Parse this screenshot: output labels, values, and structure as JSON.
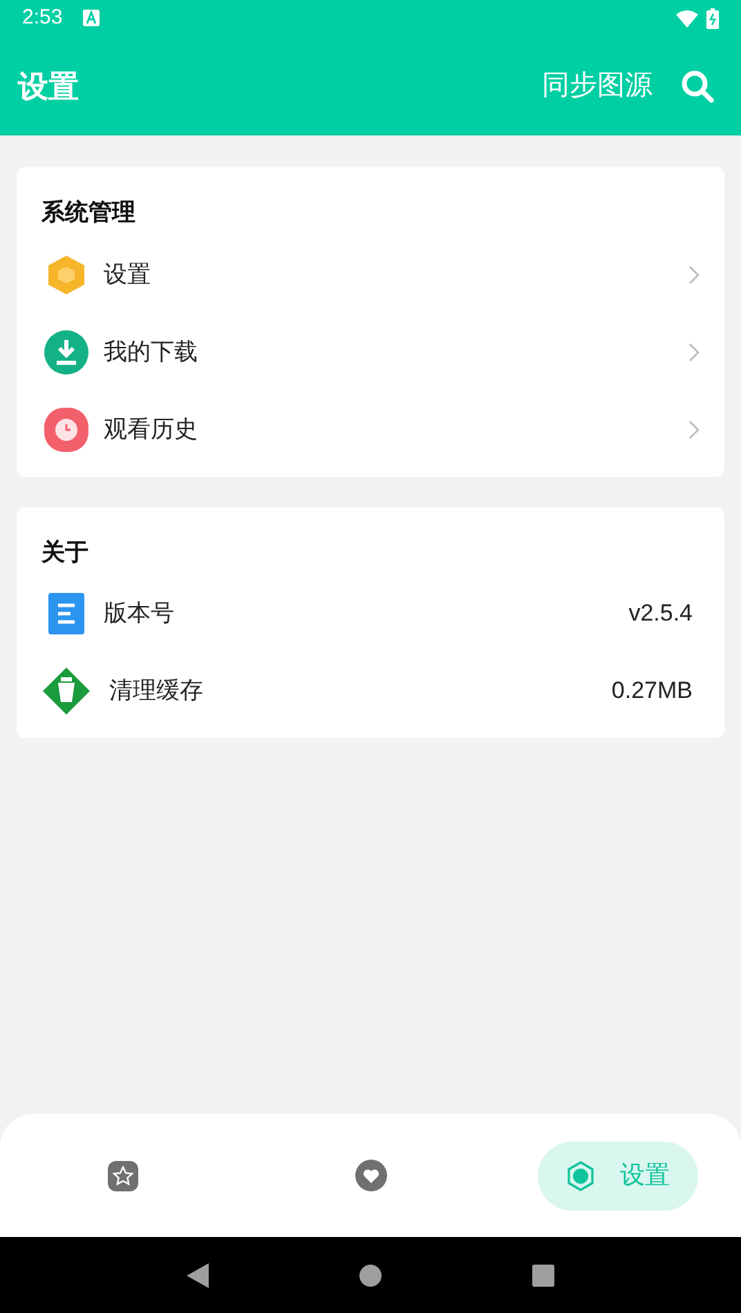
{
  "status_bar": {
    "time": "2:53"
  },
  "header": {
    "title": "设置",
    "action": "同步图源"
  },
  "sections": [
    {
      "title": "系统管理",
      "items": [
        {
          "label": "设置",
          "kind": "link"
        },
        {
          "label": "我的下载",
          "kind": "link"
        },
        {
          "label": "观看历史",
          "kind": "link"
        }
      ]
    },
    {
      "title": "关于",
      "items": [
        {
          "label": "版本号",
          "kind": "value",
          "value": "v2.5.4"
        },
        {
          "label": "清理缓存",
          "kind": "value",
          "value": "0.27MB"
        }
      ]
    }
  ],
  "bottom_nav": [
    {
      "kind": "star",
      "selected": false
    },
    {
      "kind": "heart",
      "selected": false
    },
    {
      "kind": "gear",
      "label": "设置",
      "selected": true
    }
  ]
}
